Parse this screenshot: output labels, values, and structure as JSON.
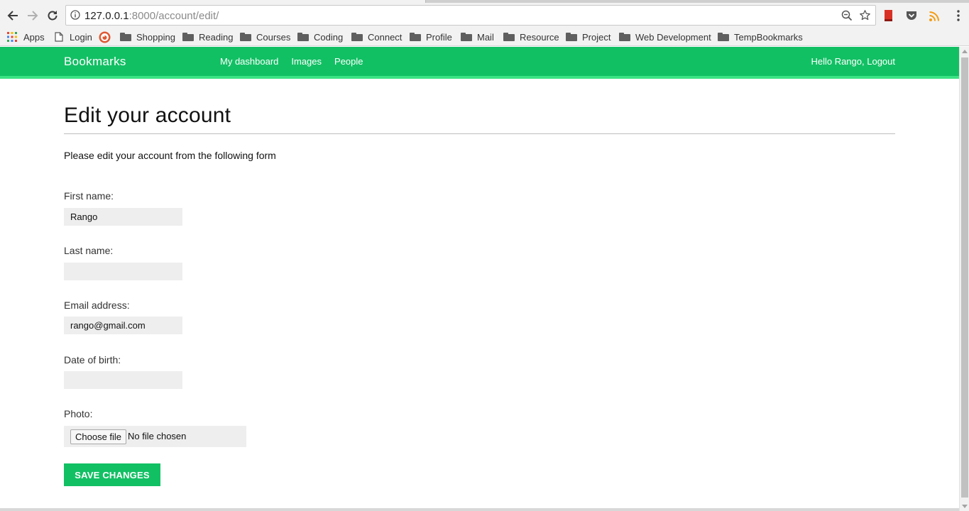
{
  "browser": {
    "url_host": "127.0.0.1",
    "url_rest": ":8000/account/edit/",
    "bookmarks": [
      {
        "label": "Apps",
        "kind": "apps"
      },
      {
        "label": "Login",
        "kind": "page"
      },
      {
        "label": "",
        "kind": "duckduckgo"
      },
      {
        "label": "Shopping",
        "kind": "folder"
      },
      {
        "label": "Reading",
        "kind": "folder"
      },
      {
        "label": "Courses",
        "kind": "folder"
      },
      {
        "label": "Coding",
        "kind": "folder"
      },
      {
        "label": "Connect",
        "kind": "folder"
      },
      {
        "label": "Profile",
        "kind": "folder"
      },
      {
        "label": "Mail",
        "kind": "folder"
      },
      {
        "label": "Resource",
        "kind": "folder"
      },
      {
        "label": "Project",
        "kind": "folder"
      },
      {
        "label": "Web Development",
        "kind": "folder"
      },
      {
        "label": "TempBookmarks",
        "kind": "folder"
      }
    ]
  },
  "site": {
    "logo": "Bookmarks",
    "menu": [
      "My dashboard",
      "Images",
      "People"
    ],
    "greeting": "Hello Rango,",
    "logout": "Logout",
    "accent_color": "#12c064"
  },
  "page": {
    "title": "Edit your account",
    "intro": "Please edit your account from the following form"
  },
  "form": {
    "first_name_label": "First name:",
    "first_name_value": "Rango",
    "last_name_label": "Last name:",
    "last_name_value": "",
    "email_label": "Email address:",
    "email_value": "rango@gmail.com",
    "dob_label": "Date of birth:",
    "dob_value": "",
    "photo_label": "Photo:",
    "choose_file": "Choose file",
    "no_file": "No file chosen",
    "submit": "SAVE CHANGES"
  }
}
